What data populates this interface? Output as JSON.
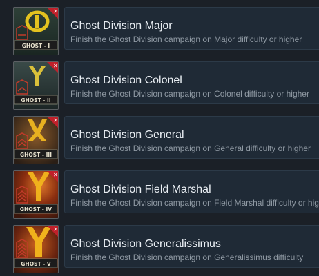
{
  "achievements": [
    {
      "title": "Ghost Division Major",
      "description": "Finish the Ghost Division campaign on Major difficulty or higher",
      "badge": "GHOST - I",
      "icon": "major-rank-icon",
      "bg_from": "#2e4038",
      "bg_to": "#1a2622",
      "emblem_color": "#e3c21f"
    },
    {
      "title": "Ghost Division Colonel",
      "description": "Finish the Ghost Division campaign on Colonel difficulty or higher",
      "badge": "GHOST - II",
      "icon": "colonel-rank-icon",
      "bg_from": "#3a4a48",
      "bg_to": "#1c2626",
      "emblem_color": "#d9bf3a"
    },
    {
      "title": "Ghost Division General",
      "description": "Finish the Ghost Division campaign on General difficulty or higher",
      "badge": "GHOST - III",
      "icon": "general-rank-icon",
      "bg_from": "#6a4a2a",
      "bg_to": "#2a1e16",
      "emblem_color": "#e8b020"
    },
    {
      "title": "Ghost Division Field Marshal",
      "description": "Finish the Ghost Division campaign on Field Marshal difficulty or higher",
      "badge": "GHOST - IV",
      "icon": "field-marshal-rank-icon",
      "bg_from": "#b24a1a",
      "bg_to": "#3a160c",
      "emblem_color": "#f2b51c"
    },
    {
      "title": "Ghost Division Generalissimus",
      "description": "Finish the Ghost Division campaign on Generalissimus difficulty",
      "badge": "GHOST - V",
      "icon": "generalissimus-rank-icon",
      "bg_from": "#8a3a14",
      "bg_to": "#2e1208",
      "emblem_color": "#f0b21c"
    }
  ]
}
